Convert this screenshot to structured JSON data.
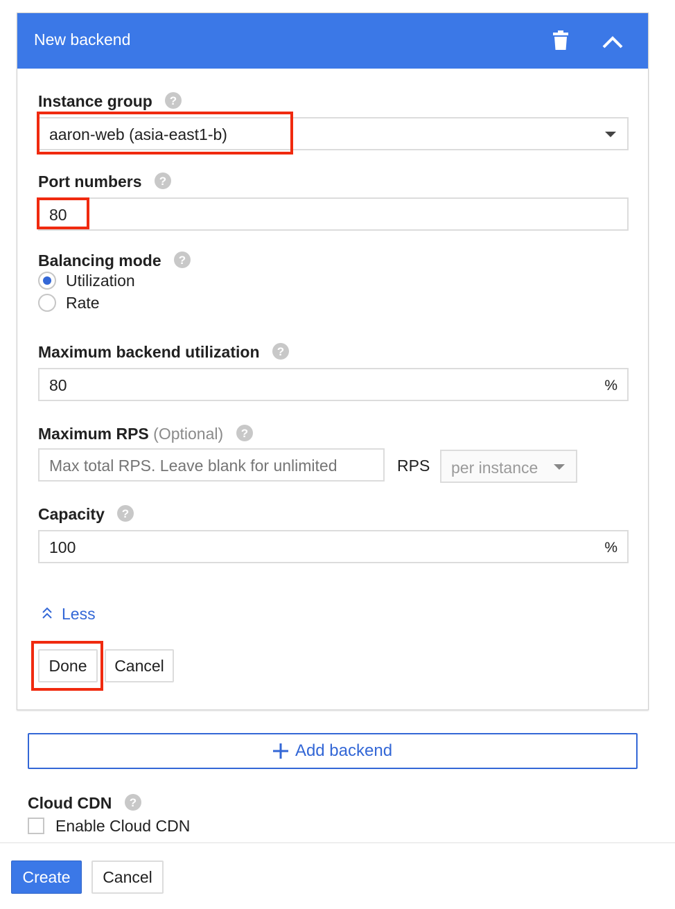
{
  "panel": {
    "title": "New backend"
  },
  "instance_group": {
    "label": "Instance group",
    "value": "aaron-web (asia-east1-b)"
  },
  "port_numbers": {
    "label": "Port numbers",
    "value": "80"
  },
  "balancing_mode": {
    "label": "Balancing mode",
    "options": [
      {
        "label": "Utilization",
        "selected": true
      },
      {
        "label": "Rate",
        "selected": false
      }
    ]
  },
  "max_utilization": {
    "label": "Maximum backend utilization",
    "value": "80",
    "suffix": "%"
  },
  "max_rps": {
    "label": "Maximum RPS",
    "optional": "(Optional)",
    "placeholder": "Max total RPS. Leave blank for unlimited",
    "unit": "RPS",
    "scope": "per instance"
  },
  "capacity": {
    "label": "Capacity",
    "value": "100",
    "suffix": "%"
  },
  "less_link": "Less",
  "panel_buttons": {
    "done": "Done",
    "cancel": "Cancel"
  },
  "add_backend": "Add backend",
  "cloud_cdn": {
    "label": "Cloud CDN",
    "checkbox_label": "Enable Cloud CDN",
    "checked": false
  },
  "footer": {
    "create": "Create",
    "cancel": "Cancel"
  },
  "colors": {
    "header_blue": "#3b78e7",
    "link_blue": "#3367d6",
    "highlight_red": "#f02a0f"
  }
}
